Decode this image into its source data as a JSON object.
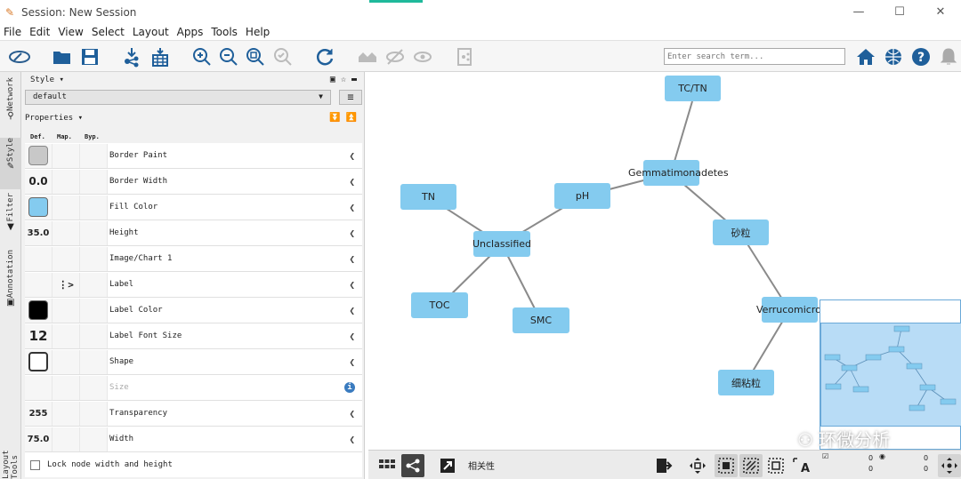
{
  "window": {
    "title": "Session: New Session",
    "controls": [
      "—",
      "☐",
      "✕"
    ]
  },
  "menu": [
    "File",
    "Edit",
    "View",
    "Select",
    "Layout",
    "Apps",
    "Tools",
    "Help"
  ],
  "search": {
    "placeholder": "Enter search term..."
  },
  "side_tabs": [
    "Network",
    "Style",
    "Filter",
    "Annotation",
    "Layout Tools"
  ],
  "style_panel": {
    "header": "Style ▾",
    "style_name": "default",
    "properties_label": "Properties ▾",
    "col_def": "Def.",
    "col_map": "Map.",
    "col_byp": "Byp.",
    "rows": [
      {
        "name": "Border Paint",
        "def": "",
        "swatch": "#c8c8c8"
      },
      {
        "name": "Border Width",
        "def": "0.0"
      },
      {
        "name": "Fill Color",
        "def": "",
        "swatch": "#84cbef"
      },
      {
        "name": "Height",
        "def": "35.0"
      },
      {
        "name": "Image/Chart 1",
        "def": ""
      },
      {
        "name": "Label",
        "def": ""
      },
      {
        "name": "Label Color",
        "def": "",
        "swatch": "#000000"
      },
      {
        "name": "Label Font Size",
        "def": "12"
      },
      {
        "name": "Shape",
        "def": ""
      },
      {
        "name": "Size",
        "def": ""
      },
      {
        "name": "Transparency",
        "def": "255"
      },
      {
        "name": "Width",
        "def": "75.0"
      }
    ],
    "lock_label": "Lock node width and height"
  },
  "network": {
    "nodes": [
      {
        "id": "tctn",
        "label": "TC/TN"
      },
      {
        "id": "gem",
        "label": "Gemmatimonadetes"
      },
      {
        "id": "ph",
        "label": "pH"
      },
      {
        "id": "tn",
        "label": "TN"
      },
      {
        "id": "uncl",
        "label": "Unclassified"
      },
      {
        "id": "sand",
        "label": "砂粒"
      },
      {
        "id": "toc",
        "label": "TOC"
      },
      {
        "id": "smc",
        "label": "SMC"
      },
      {
        "id": "verr",
        "label": "Verrucomicrobi"
      },
      {
        "id": "silt",
        "label": "细粘粒"
      }
    ]
  },
  "bottom": {
    "label": "相关性",
    "count_a": "0",
    "count_b": "0",
    "count_c": "0",
    "count_d": "0"
  },
  "watermark": "环微分析"
}
